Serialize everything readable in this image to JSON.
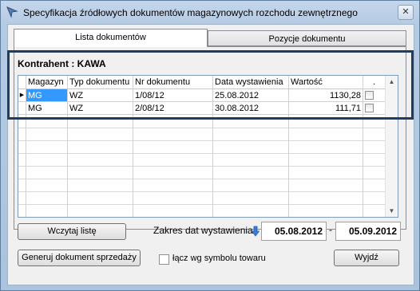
{
  "window": {
    "title": "Specyfikacja źródłowych dokumentów magazynowych rozchodu zewnętrznego",
    "close_label": "✕"
  },
  "tabs": [
    {
      "label": "Lista dokumentów",
      "active": true
    },
    {
      "label": "Pozycje dokumentu",
      "active": false
    }
  ],
  "kontrahent": "Kontrahent : KAWA",
  "grid": {
    "columns": [
      "Magazyn",
      "Typ dokumentu",
      "Nr dokumentu",
      "Data wystawienia",
      "Wartość",
      "."
    ],
    "rows": [
      {
        "magazyn": "MG",
        "typ": "WZ",
        "nr": "1/08/12",
        "data": "25.08.2012",
        "wartosc": "1130,28",
        "checked": false,
        "selected": true
      },
      {
        "magazyn": "MG",
        "typ": "WZ",
        "nr": "2/08/12",
        "data": "30.08.2012",
        "wartosc": "111,71",
        "checked": false,
        "selected": false
      }
    ]
  },
  "buttons": {
    "load_list": "Wczytaj listę",
    "generate": "Generuj dokument sprzedaży",
    "exit": "Wyjdź"
  },
  "date_range": {
    "label": "Zakres dat wystawienia",
    "from": "05.08.2012",
    "separator": "-",
    "to": "05.09.2012"
  },
  "merge_checkbox": {
    "label": "łącz wg symbolu towaru",
    "checked": false
  },
  "colors": {
    "selection": "#3399ff",
    "highlight_frame": "#1d3d63"
  }
}
